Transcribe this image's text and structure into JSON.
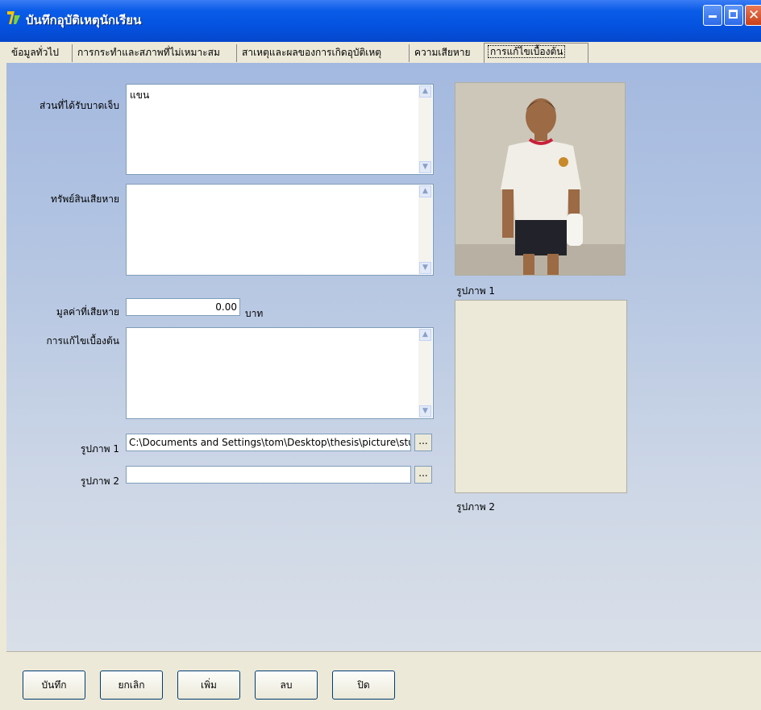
{
  "window": {
    "title": "บันทึกอุบัติเหตุนักเรียน"
  },
  "tabs": [
    {
      "label": "ข้อมูลทั่วไป"
    },
    {
      "label": "การกระทำและสภาพที่ไม่เหมาะสม"
    },
    {
      "label": "สาเหตุและผลของการเกิดอุบัติเหตุ"
    },
    {
      "label": "ความเสียหาย"
    },
    {
      "label": "การแก้ไขเบื้องต้น"
    }
  ],
  "form": {
    "injured_part": {
      "label": "ส่วนที่ได้รับบาดเจ็บ",
      "value": "แขน"
    },
    "property_damage": {
      "label": "ทรัพย์สินเสียหาย",
      "value": ""
    },
    "damage_value": {
      "label": "มูลค่าที่เสียหาย",
      "value": "0.00",
      "unit": "บาท"
    },
    "first_aid": {
      "label": "การแก้ไขเบื้องต้น",
      "value": ""
    },
    "picture1": {
      "label": "รูปภาพ 1",
      "value": "C:\\Documents and Settings\\tom\\Desktop\\thesis\\picture\\stu_"
    },
    "picture2": {
      "label": "รูปภาพ 2",
      "value": ""
    },
    "browse_label": "..."
  },
  "photos": {
    "photo1_caption": "รูปภาพ 1",
    "photo2_caption": "รูปภาพ 2"
  },
  "buttons": {
    "save": "บันทึก",
    "cancel": "ยกเลิก",
    "add": "เพิ่ม",
    "delete": "ลบ",
    "close": "ปิด"
  },
  "colors": {
    "titlebar": "#0553e0",
    "panel_top": "#a4b9e0",
    "panel_bottom": "#d9dfe8"
  }
}
